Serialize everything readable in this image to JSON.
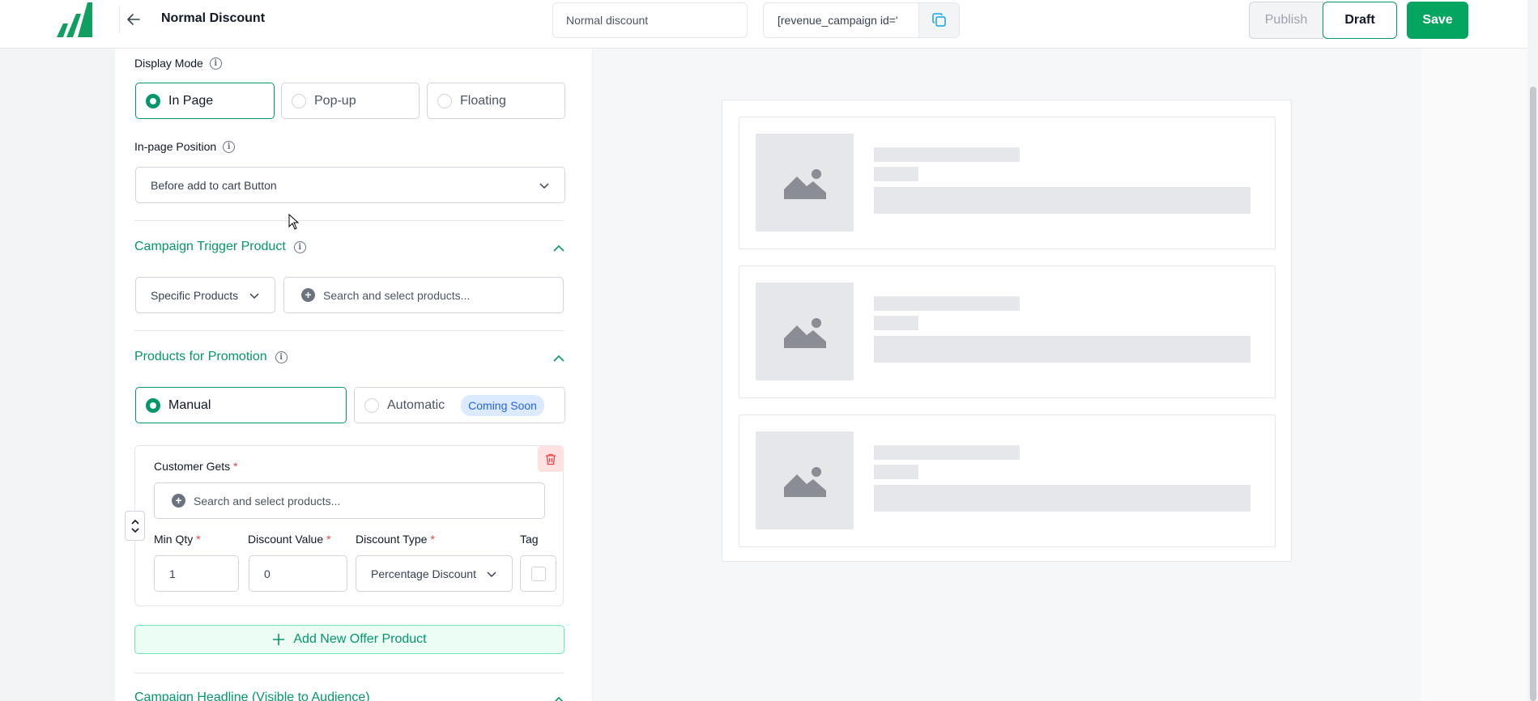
{
  "header": {
    "title": "Normal Discount",
    "campaign_name_value": "Normal discount",
    "shortcode": "[revenue_campaign id='",
    "publish_label": "Publish",
    "draft_label": "Draft",
    "save_label": "Save"
  },
  "display_mode": {
    "label": "Display Mode",
    "options": [
      "In Page",
      "Pop-up",
      "Floating"
    ],
    "selected": "In Page"
  },
  "in_page_position": {
    "label": "In-page Position",
    "value": "Before add to cart Button"
  },
  "trigger": {
    "title": "Campaign Trigger Product",
    "type_value": "Specific Products",
    "search_placeholder": "Search and select products..."
  },
  "promotion": {
    "title": "Products for Promotion",
    "options": [
      "Manual",
      "Automatic"
    ],
    "selected": "Manual",
    "coming_soon": "Coming Soon"
  },
  "offer": {
    "customer_gets_label": "Customer Gets",
    "required_mark": "*",
    "search_placeholder": "Search and select products...",
    "min_qty_label": "Min Qty",
    "discount_value_label": "Discount Value",
    "discount_type_label": "Discount Type",
    "tag_label": "Tag",
    "min_qty_value": "1",
    "discount_value": "0",
    "discount_type_value": "Percentage Discount"
  },
  "add_offer_label": "Add New Offer Product",
  "next_section_title": "Campaign Headline (Visible to Audience)",
  "colors": {
    "brand_green": "#04a560",
    "accent_green": "#059669",
    "badge_blue": "#2563eb"
  }
}
